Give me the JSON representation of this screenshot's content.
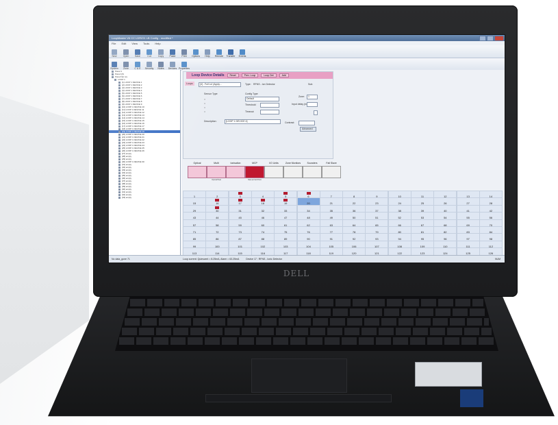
{
  "app": {
    "title": "LoopMaster V6 CC LDR/O1 LB Config - modified *",
    "menu": [
      "File",
      "Edit",
      "View",
      "Tools",
      "Help"
    ],
    "toolbar": [
      "New",
      "Open",
      "Save",
      "Cut",
      "Copy",
      "Paste",
      "Print",
      "Options",
      "Help",
      "Remote",
      "Transfer",
      "Events"
    ],
    "toolbar2": [
      "System",
      "Zone",
      "C & E",
      "Security",
      "Notes",
      "Devices",
      "Properties"
    ]
  },
  "tree": {
    "items": [
      "Panel 1",
      "Panel QS",
      "Panel Net rev",
      "LOOP 1",
      "[1] LOOP 1 DEVICE 1",
      "[2] LOOP 1 DEVICE 2",
      "[3] LOOP 1 DEVICE 3",
      "[4] LOOP 1 DEVICE 4",
      "[5] LOOP 1 DEVICE 5",
      "[6] LOOP 1 DEVICE 6",
      "[7] LOOP 1 DEVICE 7",
      "[8] LOOP 1 DEVICE 8",
      "[9] LOOP 1 DEVICE 9",
      "[10] LOOP 1 DEVICE 10",
      "[11] LOOP 1 DEVICE 11",
      "[12] LOOP 1 DEVICE 12",
      "[13] LOOP 1 DEVICE 13",
      "[14] LOOP 1 DEVICE 14",
      "[15] LOOP 1 DEVICE 15",
      "[16] LOOP 1 DEVICE 16",
      "[17] LOOP 1 DEVICE 17",
      "[18] LOOP 1 DEVICE 18",
      "[19] LOOP 1 DEVICE 19",
      "[20] LOOP 1 DEVICE 20",
      "[21] LOOP 1 DEVICE 21",
      "[22] LOOP 1 DEVICE 22",
      "[23] LOOP 1 DEVICE 23",
      "[24] LOOP 1 DEVICE 24",
      "[25] LOOP 1 DEVICE 25",
      "[26] LOOP 1 DEVICE 26",
      "[27] empty",
      "[28] empty",
      "[29] empty",
      "[30] LOOP 1 DEVICE 30",
      "[31] empty",
      "[32] empty",
      "[33] empty",
      "[34] empty",
      "[35] empty",
      "[36] empty",
      "[37] empty",
      "[38] empty",
      "[39] empty",
      "[40] empty",
      "[41] empty",
      "[42] empty",
      "[43] empty"
    ],
    "selected_index": 22,
    "footer": "No data_gone 71"
  },
  "details": {
    "sidebar_tab": "Loops",
    "title": "Loop Device Details",
    "tabs": [
      "Reset",
      "Prev. Loop",
      "Loop Det",
      "Add"
    ],
    "address_value": "[4] - Full Lcl (Apply...",
    "type_label": "Type:",
    "type_value": "RFNS - Ion Detector",
    "sub_label": "Sub:",
    "sensor_type_label": "Sensor Type",
    "config_type_label": "Config Type",
    "config_value": "Default",
    "threshold_label": "Threshold",
    "timeout_label": "Timeout",
    "zone_label": "Zone:",
    "zone_value": "1",
    "input_delay_label": "Input delay (in sec)",
    "description_label": "Description:",
    "description_value": "[LOOP 1 DEVICE 4]",
    "contrast_label": "Contrast:",
    "advanced_button": "Advanced"
  },
  "device_icons": [
    {
      "label": "Optical",
      "caption": ""
    },
    {
      "label": "Multi",
      "caption": "Optical/Heat"
    },
    {
      "label": "Ionisation",
      "caption": ""
    },
    {
      "label": "MCP",
      "caption": "Manual Call Point"
    },
    {
      "label": "I/O Units",
      "caption": ""
    },
    {
      "label": "Zone Monitors",
      "caption": ""
    },
    {
      "label": "Sounders",
      "caption": ""
    },
    {
      "label": "Fail Slave",
      "caption": ""
    }
  ],
  "grid": {
    "start": 1,
    "end": 126,
    "columns": 14,
    "highlighted": [
      20
    ],
    "devices": [
      3,
      5,
      6,
      16,
      17,
      18,
      19,
      30
    ]
  },
  "status": {
    "text": "Loop current: Quiescent = 8.25mA, Alarm = 63.25mA",
    "device": "Device 17 : RFNS - Ionic Detector",
    "right": "NUM"
  },
  "hardware": {
    "brand": "DELL"
  }
}
